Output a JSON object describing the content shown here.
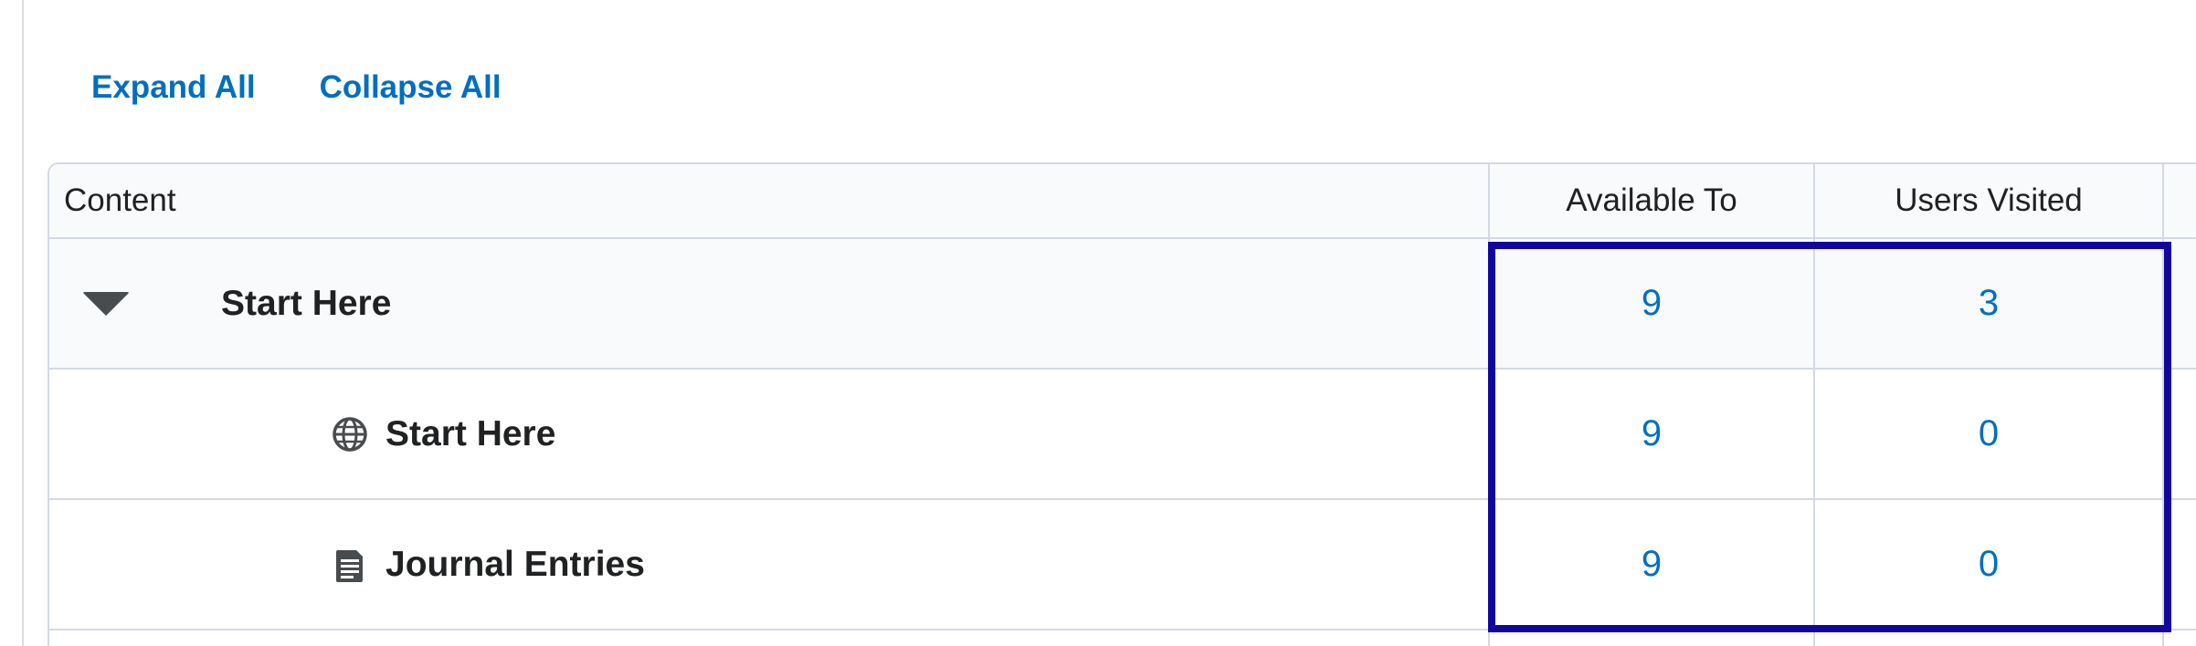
{
  "actions": {
    "expand_all": "Expand All",
    "collapse_all": "Collapse All"
  },
  "table": {
    "headers": {
      "content": "Content",
      "available_to": "Available To",
      "users_visited": "Users Visited"
    },
    "rows": [
      {
        "type": "module",
        "title": "Start Here",
        "available_to": "9",
        "users_visited": "3",
        "expanded": true
      },
      {
        "type": "link",
        "icon": "globe-icon",
        "title": "Start Here",
        "available_to": "9",
        "users_visited": "0"
      },
      {
        "type": "document",
        "icon": "document-icon",
        "title": "Journal Entries",
        "available_to": "9",
        "users_visited": "0"
      }
    ]
  },
  "colors": {
    "link": "#006fbf",
    "highlight_border": "#1205a0",
    "header_bg": "#f9fafb",
    "border": "#d3d9e3",
    "text": "#202122",
    "icon": "#494c4e"
  }
}
